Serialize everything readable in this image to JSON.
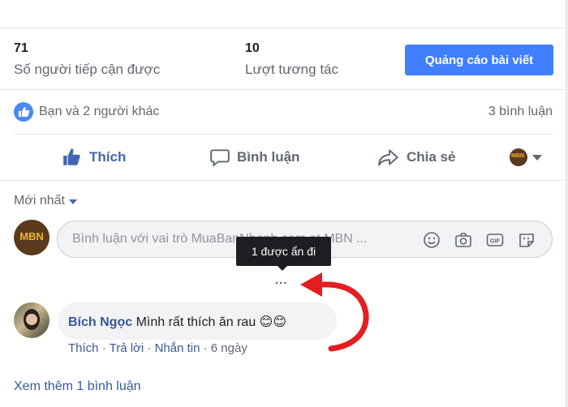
{
  "stats": {
    "reach_value": "71",
    "reach_label": "Số người tiếp cận được",
    "engagement_value": "10",
    "engagement_label": "Lượt tương tác",
    "boost_label": "Quảng cáo bài viết"
  },
  "reactions": {
    "summary": "Bạn và 2 người khác",
    "comment_count": "3 bình luận"
  },
  "actions": {
    "like": "Thích",
    "comment": "Bình luận",
    "share": "Chia sẻ"
  },
  "sort": {
    "label": "Mới nhất"
  },
  "composer": {
    "page_avatar_text": "MBN",
    "placeholder": "Bình luận với vai trò MuaBanNhanh.com at MBN ..."
  },
  "hidden": {
    "tooltip": "1 được ẩn đi",
    "dots": "..."
  },
  "comment": {
    "author": "Bích Ngọc",
    "text": "Mình rất thích ăn rau",
    "emoji": "😊😊",
    "like": "Thích",
    "reply": "Trả lời",
    "message": "Nhắn tin",
    "time": "6 ngày",
    "sep": "·"
  },
  "footer": {
    "see_more": "Xem thêm 1 bình luận"
  },
  "colors": {
    "accent": "#4267b2",
    "button": "#4080ff",
    "arrow": "#e41e20"
  }
}
